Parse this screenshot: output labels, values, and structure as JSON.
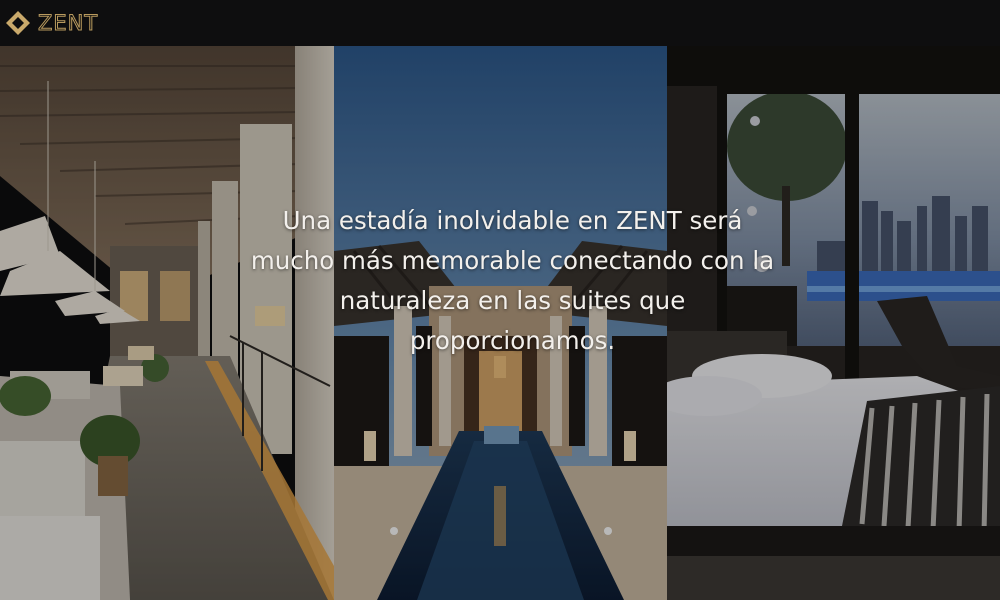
{
  "header": {
    "brand": "ZENT",
    "logo_icon": "diamond-logo-icon",
    "colors": {
      "background": "#0e0e0f",
      "accent": "#b89a5e"
    }
  },
  "hero": {
    "tagline": "Una estadía inolvidable en ZENT será mucho más memorable conectando con la naturaleza en las suites que proporcionamos.",
    "panels": [
      {
        "subject": "restaurant-terrace-photo"
      },
      {
        "subject": "courtyard-pool-photo"
      },
      {
        "subject": "city-view-bedroom-photo"
      }
    ]
  }
}
